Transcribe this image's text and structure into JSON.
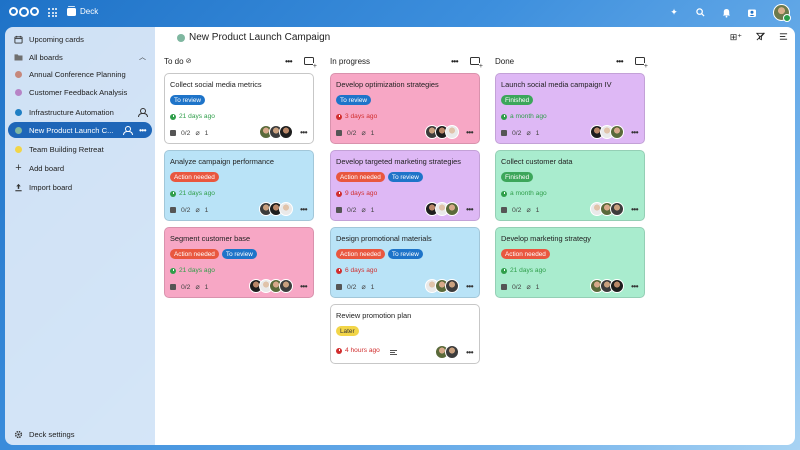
{
  "app": {
    "name": "Deck"
  },
  "colors": {
    "topbar": "#1e72c7",
    "accent": "#1e66b8",
    "label_review": "#1e74c9",
    "label_action": "#e9573f",
    "label_finished": "#3ca65a",
    "label_later": "#f2d548",
    "due_ok": "#2f9e4a",
    "due_overdue": "#d12e2e",
    "card_white": "#ffffff",
    "card_pink": "#f7a7c5",
    "card_blue": "#b9e3f7",
    "card_purple": "#deb8f5",
    "card_green": "#a9ecce"
  },
  "sidebar": {
    "upcoming": "Upcoming cards",
    "all_boards": "All boards",
    "boards": [
      {
        "label": "Annual Conference Planning",
        "color": "#c6887c"
      },
      {
        "label": "Customer Feedback Analysis",
        "color": "#b784c6"
      },
      {
        "label": "Infrastructure Automation",
        "color": "#1f7fc4"
      },
      {
        "label": "New Product Launch C...",
        "color": "#7fb7a0"
      },
      {
        "label": "Team Building Retreat",
        "color": "#f2d548"
      }
    ],
    "add_board": "Add board",
    "import_board": "Import board",
    "settings": "Deck settings"
  },
  "board": {
    "title": "New Product Launch Campaign",
    "dot_color": "#7fb7a0"
  },
  "columns": [
    {
      "name": "To do",
      "cards": [
        {
          "title": "Collect social media metrics",
          "color": "card_white",
          "labels": [
            {
              "text": "To review",
              "color": "label_review",
              "fg": "#fff"
            }
          ],
          "due": "21 days ago",
          "due_state": "ok",
          "checklist": "0/2",
          "attachments": "1",
          "avatars": 3
        },
        {
          "title": "Analyze campaign performance",
          "color": "card_blue",
          "labels": [
            {
              "text": "Action needed",
              "color": "label_action",
              "fg": "#fff"
            }
          ],
          "due": "21 days ago",
          "due_state": "ok",
          "checklist": "0/2",
          "attachments": "1",
          "avatars": 3
        },
        {
          "title": "Segment customer base",
          "color": "card_pink",
          "labels": [
            {
              "text": "Action needed",
              "color": "label_action",
              "fg": "#fff"
            },
            {
              "text": "To review",
              "color": "label_review",
              "fg": "#fff"
            }
          ],
          "due": "21 days ago",
          "due_state": "ok",
          "checklist": "0/2",
          "attachments": "1",
          "avatars": 4
        }
      ]
    },
    {
      "name": "In progress",
      "cards": [
        {
          "title": "Develop optimization strategies",
          "color": "card_pink",
          "labels": [
            {
              "text": "To review",
              "color": "label_review",
              "fg": "#fff"
            }
          ],
          "due": "3 days ago",
          "due_state": "overdue",
          "checklist": "0/2",
          "attachments": "1",
          "avatars": 3
        },
        {
          "title": "Develop targeted marketing strategies",
          "color": "card_purple",
          "labels": [
            {
              "text": "Action needed",
              "color": "label_action",
              "fg": "#fff"
            },
            {
              "text": "To review",
              "color": "label_review",
              "fg": "#fff"
            }
          ],
          "due": "9 days ago",
          "due_state": "overdue",
          "checklist": "0/2",
          "attachments": "1",
          "avatars": 3
        },
        {
          "title": "Design promotional materials",
          "color": "card_blue",
          "labels": [
            {
              "text": "Action needed",
              "color": "label_action",
              "fg": "#fff"
            },
            {
              "text": "To review",
              "color": "label_review",
              "fg": "#fff"
            }
          ],
          "due": "6 days ago",
          "due_state": "overdue",
          "checklist": "0/2",
          "attachments": "1",
          "avatars": 3
        },
        {
          "title": "Review promotion plan",
          "color": "card_white",
          "labels": [
            {
              "text": "Later",
              "color": "label_later",
              "fg": "#333"
            }
          ],
          "due": "4 hours ago",
          "due_state": "overdue",
          "checklist": "",
          "attachments": "",
          "avatars": 2,
          "has_description": true
        }
      ]
    },
    {
      "name": "Done",
      "cards": [
        {
          "title": "Launch social media campaign IV",
          "color": "card_purple",
          "labels": [
            {
              "text": "Finished",
              "color": "label_finished",
              "fg": "#fff"
            }
          ],
          "due": "a month ago",
          "due_state": "ok",
          "checklist": "0/2",
          "attachments": "1",
          "avatars": 3
        },
        {
          "title": "Collect customer data",
          "color": "card_green",
          "labels": [
            {
              "text": "Finished",
              "color": "label_finished",
              "fg": "#fff"
            }
          ],
          "due": "a month ago",
          "due_state": "ok",
          "checklist": "0/2",
          "attachments": "1",
          "avatars": 3
        },
        {
          "title": "Develop marketing strategy",
          "color": "card_green",
          "labels": [
            {
              "text": "Action needed",
              "color": "label_action",
              "fg": "#fff"
            }
          ],
          "due": "21 days ago",
          "due_state": "ok",
          "checklist": "0/2",
          "attachments": "1",
          "avatars": 3
        }
      ]
    }
  ],
  "icons": {
    "upcoming": "calendar-icon",
    "all_boards": "folder-icon",
    "add": "plus-icon",
    "import": "upload-icon",
    "settings": "gear-icon"
  }
}
